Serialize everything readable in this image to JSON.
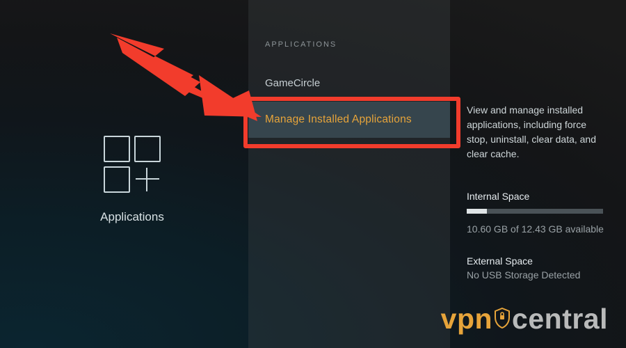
{
  "left": {
    "label": "Applications"
  },
  "mid": {
    "header": "APPLICATIONS",
    "items": [
      {
        "label": "GameCircle"
      },
      {
        "label": "Manage Installed Applications"
      }
    ]
  },
  "detail": {
    "description": "View and manage installed applications, including force stop, uninstall, clear data, and clear cache.",
    "internal": {
      "header": "Internal Space",
      "used_gb": 10.6,
      "total_gb": 12.43,
      "available_text": "10.60 GB of 12.43 GB available",
      "fill_pct": 15
    },
    "external": {
      "header": "External Space",
      "status": "No USB Storage Detected"
    }
  },
  "watermark": {
    "brand_left": "vpn",
    "brand_right": "central"
  },
  "colors": {
    "accent": "#e7a43a",
    "annotation": "#f23c2c"
  }
}
